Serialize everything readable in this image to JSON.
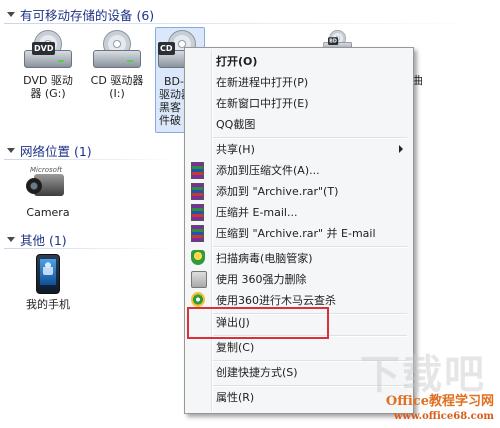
{
  "groups": {
    "devices": "有可移动存储的设备 (6)",
    "network": "网络位置 (1)",
    "other": "其他 (1)"
  },
  "devices": [
    {
      "line1": "DVD 驱动",
      "line2": "器 (G:)",
      "tag": "DVD",
      "icon": "dvd-drive-icon"
    },
    {
      "line1": "CD 驱动器",
      "line2": "(I:)",
      "tag": "",
      "icon": "cd-drive-icon"
    },
    {
      "line1": "BD-",
      "line2": "驱动器",
      "line3": "黑客",
      "line4": "件破",
      "tag": "CD",
      "icon": "bd-drive-icon"
    },
    {
      "line1": "曲",
      "tag": "BD",
      "icon": "drive-icon"
    }
  ],
  "network": [
    {
      "label": "Camera",
      "icon": "camera-icon"
    }
  ],
  "other": [
    {
      "label": "我的手机",
      "icon": "phone-icon"
    }
  ],
  "menu": [
    {
      "label": "打开(O)",
      "bold": true
    },
    {
      "label": "在新进程中打开(P)"
    },
    {
      "label": "在新窗口中打开(E)"
    },
    {
      "label": "QQ截图"
    },
    {
      "label": "共享(H)",
      "submenu": true
    },
    {
      "label": "添加到压缩文件(A)...",
      "icon": "winrar-icon"
    },
    {
      "label": "添加到 \"Archive.rar\"(T)",
      "icon": "winrar-icon"
    },
    {
      "label": "压缩并 E-mail...",
      "icon": "winrar-icon"
    },
    {
      "label": "压缩到 \"Archive.rar\" 并 E-mail",
      "icon": "winrar-icon"
    },
    {
      "label": "扫描病毒(电脑管家)",
      "icon": "shield-icon"
    },
    {
      "label": "使用 360强力删除",
      "icon": "shredder-icon"
    },
    {
      "label": "使用360进行木马云查杀",
      "icon": "360-icon"
    },
    {
      "label": "弹出(J)"
    },
    {
      "label": "复制(C)"
    },
    {
      "label": "创建快捷方式(S)"
    },
    {
      "label": "属性(R)"
    }
  ],
  "watermark": {
    "brand": "Office教程学习网",
    "url": "www.office68.com"
  }
}
